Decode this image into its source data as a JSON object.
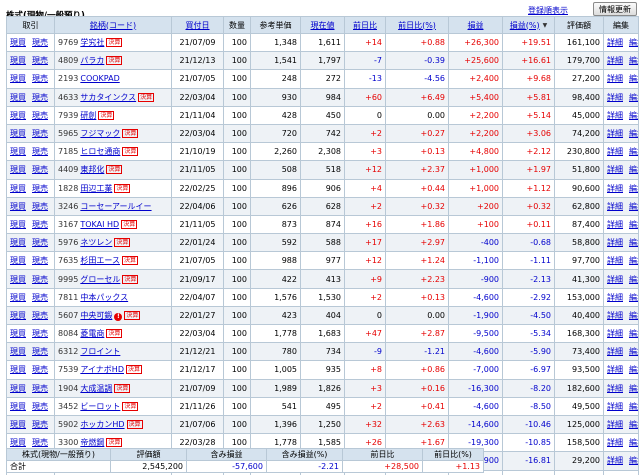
{
  "section_title": "株式(現物/一般預り)",
  "register_link": "登録順表示",
  "refresh_button": "情報更新",
  "headers": {
    "trade": "取引",
    "stock": "銘柄(コード)",
    "buy_date": "買付日",
    "qty": "数量",
    "ref_price": "参考単価",
    "cur_price": "現在値",
    "day_change": "前日比",
    "day_change_pct": "前日比(%)",
    "pnl": "損益",
    "pnl_pct": "損益(%)",
    "value": "評価額",
    "edit": "編集"
  },
  "sort_arrow": "▼",
  "actions": {
    "buy": "現買",
    "sell": "現売",
    "detail": "詳細",
    "edit": "編集"
  },
  "badge_text": "決算",
  "alert_text": "!",
  "rows": [
    {
      "code": "9769",
      "name": "学究社",
      "badge": true,
      "date": "21/07/09",
      "qty": "100",
      "ref": "1,348",
      "cur": "1,611",
      "chg": "+14",
      "chg_pct": "+0.88",
      "pnl": "+26,300",
      "pnl_pct": "+19.51",
      "val": "161,100"
    },
    {
      "code": "4809",
      "name": "パラカ",
      "badge": true,
      "date": "21/12/13",
      "qty": "100",
      "ref": "1,541",
      "cur": "1,797",
      "chg": "-7",
      "chg_pct": "-0.39",
      "pnl": "+25,600",
      "pnl_pct": "+16.61",
      "val": "179,700"
    },
    {
      "code": "2193",
      "name": "COOKPAD",
      "badge": false,
      "date": "21/07/05",
      "qty": "100",
      "ref": "248",
      "cur": "272",
      "chg": "-13",
      "chg_pct": "-4.56",
      "pnl": "+2,400",
      "pnl_pct": "+9.68",
      "val": "27,200"
    },
    {
      "code": "4633",
      "name": "サカタインクス",
      "badge": true,
      "date": "22/03/04",
      "qty": "100",
      "ref": "930",
      "cur": "984",
      "chg": "+60",
      "chg_pct": "+6.49",
      "pnl": "+5,400",
      "pnl_pct": "+5.81",
      "val": "98,400"
    },
    {
      "code": "7939",
      "name": "研創",
      "badge": true,
      "date": "21/11/04",
      "qty": "100",
      "ref": "428",
      "cur": "450",
      "chg": "0",
      "chg_pct": "0.00",
      "pnl": "+2,200",
      "pnl_pct": "+5.14",
      "val": "45,000"
    },
    {
      "code": "5965",
      "name": "フジマック",
      "badge": true,
      "date": "22/03/04",
      "qty": "100",
      "ref": "720",
      "cur": "742",
      "chg": "+2",
      "chg_pct": "+0.27",
      "pnl": "+2,200",
      "pnl_pct": "+3.06",
      "val": "74,200"
    },
    {
      "code": "7185",
      "name": "ヒロセ通商",
      "badge": true,
      "date": "21/10/19",
      "qty": "100",
      "ref": "2,260",
      "cur": "2,308",
      "chg": "+3",
      "chg_pct": "+0.13",
      "pnl": "+4,800",
      "pnl_pct": "+2.12",
      "val": "230,800"
    },
    {
      "code": "4409",
      "name": "東邦化",
      "badge": true,
      "date": "21/11/05",
      "qty": "100",
      "ref": "508",
      "cur": "518",
      "chg": "+12",
      "chg_pct": "+2.37",
      "pnl": "+1,000",
      "pnl_pct": "+1.97",
      "val": "51,800"
    },
    {
      "code": "1828",
      "name": "田辺工業",
      "badge": true,
      "date": "22/02/25",
      "qty": "100",
      "ref": "896",
      "cur": "906",
      "chg": "+4",
      "chg_pct": "+0.44",
      "pnl": "+1,000",
      "pnl_pct": "+1.12",
      "val": "90,600"
    },
    {
      "code": "3246",
      "name": "コーセーアールイー",
      "badge": false,
      "date": "22/04/06",
      "qty": "100",
      "ref": "626",
      "cur": "628",
      "chg": "+2",
      "chg_pct": "+0.32",
      "pnl": "+200",
      "pnl_pct": "+0.32",
      "val": "62,800"
    },
    {
      "code": "3167",
      "name": "TOKAI HD",
      "badge": true,
      "date": "21/11/05",
      "qty": "100",
      "ref": "873",
      "cur": "874",
      "chg": "+16",
      "chg_pct": "+1.86",
      "pnl": "+100",
      "pnl_pct": "+0.11",
      "val": "87,400"
    },
    {
      "code": "5976",
      "name": "ネツレン",
      "badge": true,
      "date": "22/01/24",
      "qty": "100",
      "ref": "592",
      "cur": "588",
      "chg": "+17",
      "chg_pct": "+2.97",
      "pnl": "-400",
      "pnl_pct": "-0.68",
      "val": "58,800"
    },
    {
      "code": "7635",
      "name": "杉田エース",
      "badge": true,
      "date": "21/07/05",
      "qty": "100",
      "ref": "988",
      "cur": "977",
      "chg": "+12",
      "chg_pct": "+1.24",
      "pnl": "-1,100",
      "pnl_pct": "-1.11",
      "val": "97,700"
    },
    {
      "code": "9995",
      "name": "グローセル",
      "badge": true,
      "date": "21/09/17",
      "qty": "100",
      "ref": "422",
      "cur": "413",
      "chg": "+9",
      "chg_pct": "+2.23",
      "pnl": "-900",
      "pnl_pct": "-2.13",
      "val": "41,300"
    },
    {
      "code": "7811",
      "name": "中本パックス",
      "badge": false,
      "date": "22/04/07",
      "qty": "100",
      "ref": "1,576",
      "cur": "1,530",
      "chg": "+2",
      "chg_pct": "+0.13",
      "pnl": "-4,600",
      "pnl_pct": "-2.92",
      "val": "153,000"
    },
    {
      "code": "5607",
      "name": "中央可鍛",
      "badge": true,
      "alert": true,
      "date": "22/01/27",
      "qty": "100",
      "ref": "423",
      "cur": "404",
      "chg": "0",
      "chg_pct": "0.00",
      "pnl": "-1,900",
      "pnl_pct": "-4.50",
      "val": "40,400"
    },
    {
      "code": "8084",
      "name": "菱電商",
      "badge": true,
      "date": "22/03/04",
      "qty": "100",
      "ref": "1,778",
      "cur": "1,683",
      "chg": "+47",
      "chg_pct": "+2.87",
      "pnl": "-9,500",
      "pnl_pct": "-5.34",
      "val": "168,300"
    },
    {
      "code": "6312",
      "name": "フロイント",
      "badge": false,
      "date": "21/12/21",
      "qty": "100",
      "ref": "780",
      "cur": "734",
      "chg": "-9",
      "chg_pct": "-1.21",
      "pnl": "-4,600",
      "pnl_pct": "-5.90",
      "val": "73,400"
    },
    {
      "code": "7539",
      "name": "アイナボHD",
      "badge": true,
      "date": "21/12/17",
      "qty": "100",
      "ref": "1,005",
      "cur": "935",
      "chg": "+8",
      "chg_pct": "+0.86",
      "pnl": "-7,000",
      "pnl_pct": "-6.97",
      "val": "93,500"
    },
    {
      "code": "1904",
      "name": "大成温調",
      "badge": true,
      "date": "21/07/09",
      "qty": "100",
      "ref": "1,989",
      "cur": "1,826",
      "chg": "+3",
      "chg_pct": "+0.16",
      "pnl": "-16,300",
      "pnl_pct": "-8.20",
      "val": "182,600"
    },
    {
      "code": "3452",
      "name": "ビーロット",
      "badge": true,
      "date": "21/11/26",
      "qty": "100",
      "ref": "541",
      "cur": "495",
      "chg": "+2",
      "chg_pct": "+0.41",
      "pnl": "-4,600",
      "pnl_pct": "-8.50",
      "val": "49,500"
    },
    {
      "code": "5902",
      "name": "ホッカンHD",
      "badge": true,
      "date": "21/07/06",
      "qty": "100",
      "ref": "1,396",
      "cur": "1,250",
      "chg": "+32",
      "chg_pct": "+2.63",
      "pnl": "-14,600",
      "pnl_pct": "-10.46",
      "val": "125,000"
    },
    {
      "code": "3300",
      "name": "帝燃鋼",
      "badge": true,
      "date": "22/03/28",
      "qty": "100",
      "ref": "1,778",
      "cur": "1,585",
      "chg": "+26",
      "chg_pct": "+1.67",
      "pnl": "-19,300",
      "pnl_pct": "-10.85",
      "val": "158,500"
    },
    {
      "code": "1726",
      "name": "Br. HD",
      "badge": true,
      "date": "21/10/25",
      "qty": "100",
      "ref": "351",
      "cur": "292",
      "chg": "+6",
      "chg_pct": "+2.10",
      "pnl": "-5,900",
      "pnl_pct": "-16.81",
      "val": "29,200"
    },
    {
      "code": "3738",
      "name": "ティーガイア",
      "badge": true,
      "date": "21/10/25",
      "qty": "100",
      "ref": "2,032",
      "cur": "1,649",
      "chg": "+37",
      "chg_pct": "+2.30",
      "pnl": "-38,300",
      "pnl_pct": "-18.85",
      "val": "164,900"
    }
  ],
  "summary": {
    "headers": {
      "label": "株式(現物/一般預り)",
      "value": "評価額",
      "unrealized": "含み損益",
      "unrealized_pct": "含み損益(%)",
      "day": "前日比",
      "day_pct": "前日比(%)"
    },
    "label": "合計",
    "value": "2,545,200",
    "unrealized": "-57,600",
    "unrealized_pct": "-2.21",
    "day": "+28,500",
    "day_pct": "+1.13"
  },
  "colors": {
    "header_bg": "#d5e2ee",
    "stripe": "#eef2f6",
    "link": "#0000cc",
    "positive": "#e60000",
    "negative": "#0000cc",
    "border": "#b8c8d6"
  }
}
